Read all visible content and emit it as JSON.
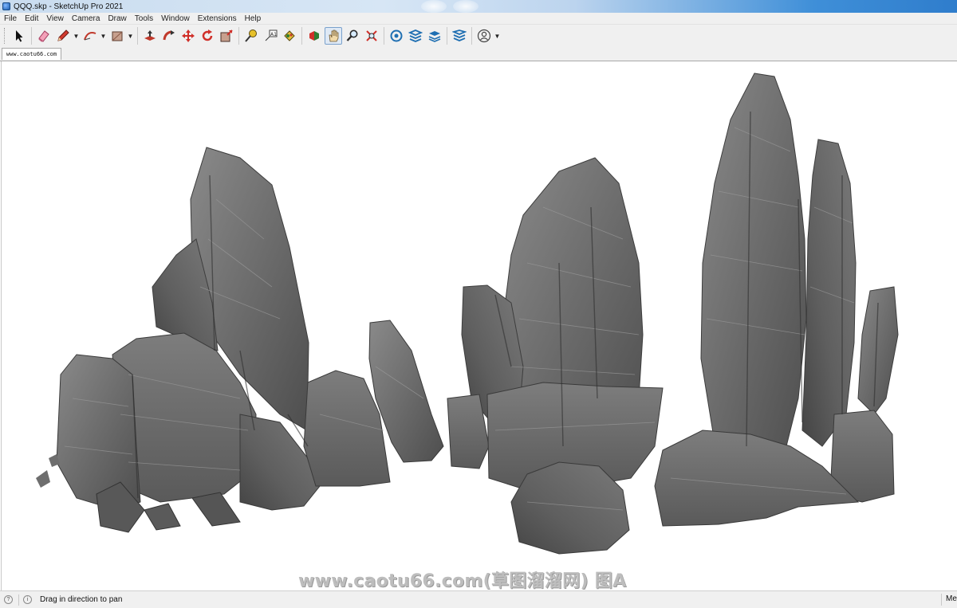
{
  "window": {
    "title": "QQQ.skp - SketchUp Pro 2021"
  },
  "menu": [
    "File",
    "Edit",
    "View",
    "Camera",
    "Draw",
    "Tools",
    "Window",
    "Extensions",
    "Help"
  ],
  "toolbar": {
    "tools": [
      "select-icon",
      "eraser-icon",
      "pencil-line-icon",
      "arc-icon",
      "rectangle-icon",
      "push-pull-icon",
      "follow-me-icon",
      "move-icon",
      "rotate-icon",
      "scale-icon",
      "tape-measure-icon",
      "text-icon",
      "paint-bucket-icon",
      "orbit-icon",
      "pan-icon",
      "zoom-icon",
      "zoom-extents-icon",
      "warehouse-icon",
      "extension-warehouse-icon",
      "layout-icon",
      "trimble-connect-icon",
      "account-icon"
    ],
    "active_tool": "pan-icon"
  },
  "tabs": [
    {
      "label": "www.caotu66.com"
    }
  ],
  "viewport": {
    "background": "#ffffff",
    "rock_color": "#6f6f6f",
    "watermark": "www.caotu66.com(草图溜溜网) 图A"
  },
  "status": {
    "message": "Drag in direction to pan",
    "right_label": "Me"
  }
}
